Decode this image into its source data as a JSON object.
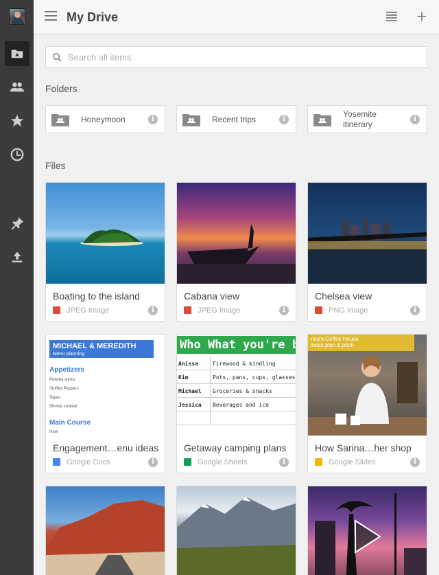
{
  "header": {
    "title": "My Drive"
  },
  "search": {
    "placeholder": "Search all items",
    "value": ""
  },
  "sections": {
    "folders_label": "Folders",
    "files_label": "Files"
  },
  "folders": [
    {
      "name": "Honeymoon"
    },
    {
      "name": "Recent trips"
    },
    {
      "name": "Yosemite",
      "name_line2": "itinerary"
    }
  ],
  "files": [
    {
      "name": "Boating to the island",
      "type": "JPEG Image",
      "icon": "image-icon",
      "color": "#dd4b39"
    },
    {
      "name": "Cabana view",
      "type": "JPEG Image",
      "icon": "image-icon",
      "color": "#dd4b39"
    },
    {
      "name": "Chelsea view",
      "type": "PNG Image",
      "icon": "image-icon",
      "color": "#dd4b39"
    },
    {
      "name": "Engagement…enu ideas",
      "type": "Google Docs",
      "icon": "docs-icon",
      "color": "#4285f4"
    },
    {
      "name": "Getaway camping plans",
      "type": "Google Sheets",
      "icon": "sheets-icon",
      "color": "#0f9d58"
    },
    {
      "name": "How Sarina…her shop",
      "type": "Google Slides",
      "icon": "slides-icon",
      "color": "#f4b400"
    }
  ],
  "doc_thumb": {
    "heading": "MICHAEL & MEREDITH",
    "subheading": "Menu planning",
    "section1": "Appetizers",
    "items1": [
      "Polenta sticks",
      "Stuffed Peppers",
      "Tapas",
      "Shrimp cocktail"
    ],
    "section2": "Main Course",
    "items2": [
      "Ham"
    ]
  },
  "sheet_thumb": {
    "header": "Who  What you're b",
    "rows": [
      {
        "who": "Anissa",
        "what": "Firewood & kindling"
      },
      {
        "who": "Kim",
        "what": "Pots, pans, cups, glasses (pape"
      },
      {
        "who": "Michael",
        "what": "Groceries & snacks"
      },
      {
        "who": "Jessica",
        "what": "Beverages and ice"
      }
    ]
  },
  "slide_thumb": {
    "line1": "rina's Coffee House",
    "line2": "iness plan & pitch"
  }
}
